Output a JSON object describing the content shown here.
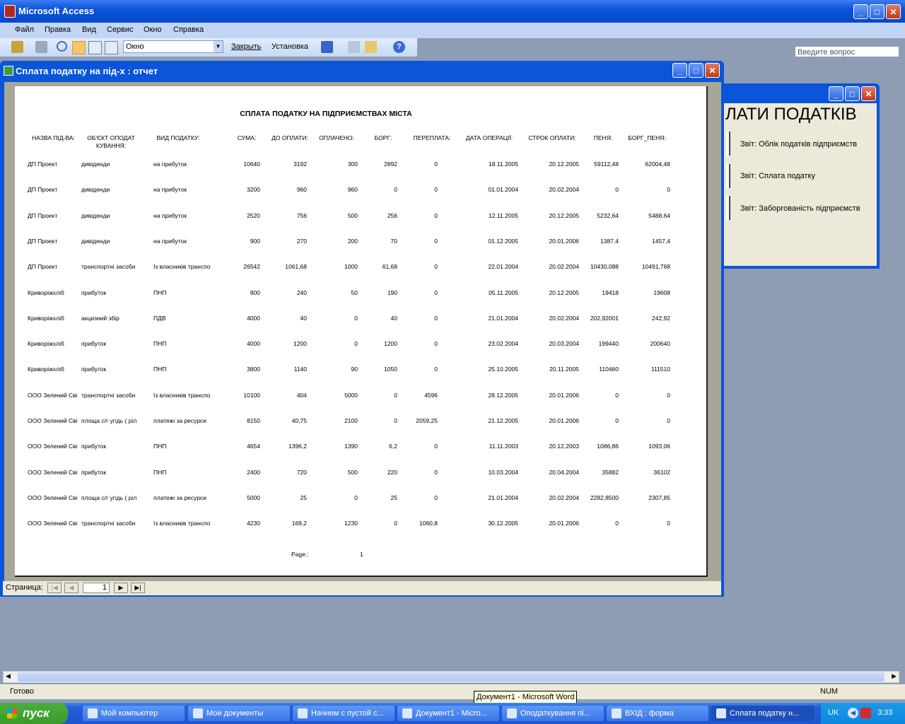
{
  "app": {
    "title": "Microsoft Access",
    "ask_placeholder": "Введите вопрос",
    "status": "Готово",
    "num_indicator": "NUM",
    "tooltip": "Документ1 - Microsoft Word"
  },
  "menu": [
    "Файл",
    "Правка",
    "Вид",
    "Сервис",
    "Окно",
    "Справка"
  ],
  "toolbar": {
    "zoom_value": "Окно",
    "close_label": "Закрыть",
    "setup_label": "Установка"
  },
  "background_form": {
    "heading": "ЛАТИ ПОДАТКІВ",
    "buttons": [
      "Звіт: Облік податків підприємств",
      "Звіт: Сплата податку",
      "Звіт: Заборгованість підприємств"
    ]
  },
  "report_window": {
    "title": "Сплата податку на під-х : отчет",
    "nav_label": "Страница:",
    "nav_page": "1"
  },
  "report": {
    "title": "СПЛАТА ПОДАТКУ НА ПІДПРИЄМСТВАХ МІСТА",
    "columns": [
      "НАЗВА ПІД-ВА:",
      "ОБ'ЄКТ ОПОДАТ КУВАННЯ:",
      "ВИД ПОДАТКУ:",
      "СУМА:",
      "ДО ОПЛАТИ:",
      "ОПЛАЧЕНО:",
      "БОРГ:",
      "ПЕРЕПЛАТА:",
      "ДАТА ОПЕРАЦІЇ:",
      "СТРОК ОПЛАТИ:",
      "ПЕНЯ:",
      "БОРГ_ПЕНЯ:"
    ],
    "rows": [
      [
        "ДП Проект",
        "дивіденди",
        "на прибуток",
        "10640",
        "3192",
        "300",
        "2892",
        "0",
        "18.11.2005",
        "20.12.2005",
        "59112,48",
        "62004,48"
      ],
      [
        "ДП Проект",
        "дивіденди",
        "на прибуток",
        "3200",
        "960",
        "960",
        "0",
        "0",
        "01.01.2004",
        "20.02.2004",
        "0",
        "0"
      ],
      [
        "ДП Проект",
        "дивіденди",
        "на прибуток",
        "2520",
        "756",
        "500",
        "256",
        "0",
        "12.11.2005",
        "20.12.2005",
        "5232,64",
        "5488,64"
      ],
      [
        "ДП Проект",
        "дивіденди",
        "на прибуток",
        "900",
        "270",
        "200",
        "70",
        "0",
        "01.12.2005",
        "20.01.2006",
        "1387,4",
        "1457,4"
      ],
      [
        "ДП Проект",
        "транспортні засоби",
        "Із власників транспо",
        "26542",
        "1061,68",
        "1000",
        "61,68",
        "0",
        "22.01.2004",
        "20.02.2004",
        "10430,088",
        "10491,768"
      ],
      [
        "Криворіжхліб",
        "прибуток",
        "ПНП",
        "800",
        "240",
        "50",
        "190",
        "0",
        "05.11.2005",
        "20.12.2005",
        "19418",
        "19608"
      ],
      [
        "Криворіжхліб",
        "акцизний збір",
        "ПДВ",
        "4000",
        "40",
        "0",
        "40",
        "0",
        "21.01.2004",
        "20.02.2004",
        "202,92001",
        "242,92"
      ],
      [
        "Криворіжхліб",
        "прибуток",
        "ПНП",
        "4000",
        "1200",
        "0",
        "1200",
        "0",
        "23.02.2004",
        "20.03.2004",
        "199440",
        "200640"
      ],
      [
        "Криворіжхліб",
        "прибуток",
        "ПНП",
        "3800",
        "1140",
        "90",
        "1050",
        "0",
        "25.10.2005",
        "20.11.2005",
        "110460",
        "111510"
      ],
      [
        "ООО Зелений Сві",
        "транспортні засоби",
        "Із власників транспо",
        "10100",
        "404",
        "5000",
        "0",
        "4596",
        "28.12.2005",
        "20.01.2006",
        "0",
        "0"
      ],
      [
        "ООО Зелений Сві",
        "площа с/г угідь ( ріл",
        "платежі за ресурси",
        "8150",
        "40,75",
        "2100",
        "0",
        "2059,25",
        "21.12.2005",
        "20.01.2006",
        "0",
        "0"
      ],
      [
        "ООО Зелений Сві",
        "прибуток",
        "ПНП",
        "4654",
        "1396,2",
        "1390",
        "6,2",
        "0",
        "11.11.2003",
        "20.12.2003",
        "1086,86",
        "1093,06"
      ],
      [
        "ООО Зелений Сві",
        "прибуток",
        "ПНП",
        "2400",
        "720",
        "500",
        "220",
        "0",
        "10.03.2004",
        "20.04.2004",
        "35882",
        "36102"
      ],
      [
        "ООО Зелений Сві",
        "площа с/г угідь ( ріл",
        "платежі за ресурси",
        "5000",
        "25",
        "0",
        "25",
        "0",
        "21.01.2004",
        "20.02.2004",
        "2282,8500",
        "2307,85"
      ],
      [
        "ООО Зелений Сві",
        "транспортні засоби",
        "Із власників транспо",
        "4230",
        "169,2",
        "1230",
        "0",
        "1060,8",
        "30.12.2005",
        "20.01.2006",
        "0",
        "0"
      ]
    ],
    "footer_label": "Page::",
    "footer_page": "1"
  },
  "taskbar": {
    "start_label": "пуск",
    "tasks": [
      "Мой компьютер",
      "Мои документы",
      "Начнем с пустой с...",
      "Документ1 - Micro...",
      "Оподаткування пі...",
      "ВХІД : форма",
      "Сплата податку н..."
    ],
    "lang": "UK",
    "clock": "3:33"
  }
}
